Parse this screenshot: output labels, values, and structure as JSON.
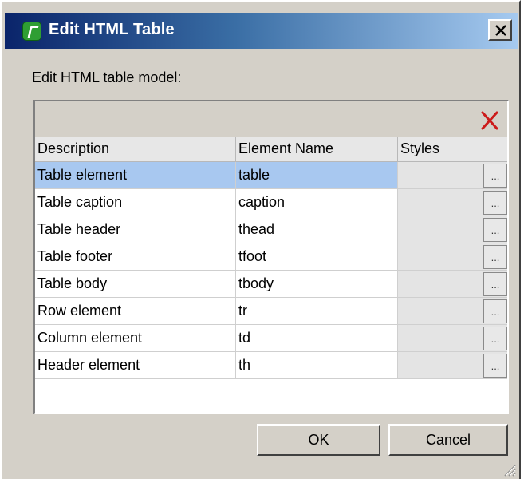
{
  "dialog": {
    "title": "Edit HTML Table",
    "title_icon": "xmlspy-app-icon",
    "close_glyph": "close-icon"
  },
  "model_label": "Edit HTML table model:",
  "toolbar": {
    "delete_icon": "delete-x-icon",
    "delete_color": "#cc1a1a"
  },
  "table": {
    "columns": [
      "Description",
      "Element Name",
      "Styles"
    ],
    "rows": [
      {
        "description": "Table element",
        "element": "table",
        "styles_button": "...",
        "selected": true
      },
      {
        "description": "Table caption",
        "element": "caption",
        "styles_button": "..."
      },
      {
        "description": "Table header",
        "element": "thead",
        "styles_button": "..."
      },
      {
        "description": "Table footer",
        "element": "tfoot",
        "styles_button": "..."
      },
      {
        "description": "Table body",
        "element": "tbody",
        "styles_button": "..."
      },
      {
        "description": "Row element",
        "element": "tr",
        "styles_button": "..."
      },
      {
        "description": "Column element",
        "element": "td",
        "styles_button": "..."
      },
      {
        "description": "Header element",
        "element": "th",
        "styles_button": "..."
      }
    ]
  },
  "buttons": {
    "ok": "OK",
    "cancel": "Cancel"
  },
  "colors": {
    "title_gradient_start": "#0a246a",
    "title_gradient_end": "#a6caf0",
    "selection": "#a8c8f0",
    "dialog_face": "#d4d0c8"
  }
}
